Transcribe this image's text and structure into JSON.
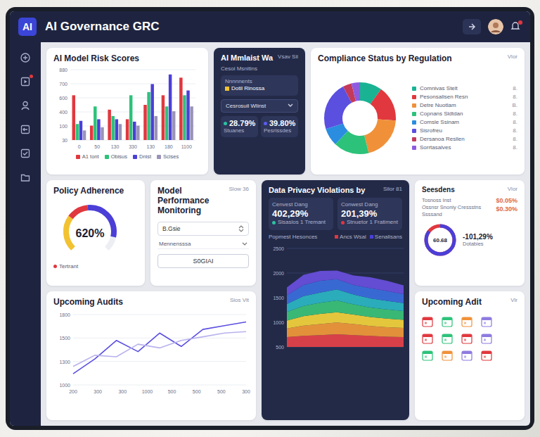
{
  "window": {
    "logo": "AI",
    "title": "AI Governance GRC"
  },
  "header": {
    "notifications_badge": true
  },
  "sidebar": {
    "items": [
      {
        "badge": false
      },
      {
        "badge": true
      },
      {
        "badge": false
      },
      {
        "badge": false
      },
      {
        "badge": false
      },
      {
        "badge": false
      }
    ]
  },
  "risk_chart": {
    "title": "AI Model Risk Scores",
    "y_ticks": [
      "880",
      "700",
      "600",
      "400",
      "100",
      "30"
    ],
    "x_labels": [
      "0",
      "50",
      "130",
      "330",
      "130",
      "180",
      "1100"
    ],
    "max": 880,
    "series": [
      {
        "name": "A1 tont",
        "color": "#e0383e",
        "values": [
          560,
          180,
          380,
          260,
          440,
          560,
          780
        ]
      },
      {
        "name": "Obisus",
        "color": "#2cc27a",
        "values": [
          200,
          420,
          300,
          560,
          600,
          420,
          560
        ]
      },
      {
        "name": "Dnist",
        "color": "#4b3fd8",
        "values": [
          240,
          260,
          260,
          230,
          700,
          820,
          620
        ]
      },
      {
        "name": "Scises",
        "color": "#9a93b8",
        "values": [
          120,
          160,
          200,
          180,
          300,
          360,
          420
        ]
      }
    ]
  },
  "ai_monitor": {
    "title": "AI Mmlaist Wa",
    "link": "Vsav Sii",
    "subtitle": "Cesoi Msnitins",
    "field_label": "Nnnnnents",
    "field_value": "Dotil Rinossa",
    "dropdown": "Cesrosuil Wlinst",
    "stats": [
      {
        "value": "28.79%",
        "label": "Stuanes",
        "color": "#2cc2a0"
      },
      {
        "value": "39.80%",
        "label": "Pesrissdes",
        "color": "#5b5cf0"
      }
    ]
  },
  "compliance": {
    "title": "Compliance Status by Regulation",
    "link": "Vlor",
    "items": [
      {
        "label": "Comnivas Stelt",
        "reading": "8.",
        "color": "#19b394",
        "value": 10
      },
      {
        "label": "Pesonsalisen Resn",
        "reading": "8.",
        "color": "#e0383e",
        "value": 16
      },
      {
        "label": "Detre Nuotlam",
        "reading": "B.",
        "color": "#f0913a",
        "value": 20
      },
      {
        "label": "Copnans Sldtdan",
        "reading": "8.",
        "color": "#2cc27a",
        "value": 16
      },
      {
        "label": "Comsle Ssinam",
        "reading": "8.",
        "color": "#2a8de0",
        "value": 8
      },
      {
        "label": "Sisrofreu",
        "reading": "8.",
        "color": "#5b4fe0",
        "value": 22
      },
      {
        "label": "Dersanoa Resllen",
        "reading": "8.",
        "color": "#c43a5a",
        "value": 4
      },
      {
        "label": "Sorrtasalves",
        "reading": "8.",
        "color": "#8e5be0",
        "value": 4
      }
    ]
  },
  "policy": {
    "title": "Policy Adherence",
    "value": "620%",
    "label": "Tertrant",
    "label_color": "#e0383e",
    "segments": [
      {
        "color": "#f2c230",
        "share": 0.3
      },
      {
        "color": "#e0383e",
        "share": 0.18
      },
      {
        "color": "#4b3fd8",
        "share": 0.4
      }
    ]
  },
  "model_performance": {
    "title": "Model Performance Monitoring",
    "link": "Slow 36",
    "select": "B.Gsie",
    "dropdown": "Mennensssa",
    "button": "S0GIAI"
  },
  "privacy": {
    "title": "Data Privacy Violations by",
    "link": "Silor 81",
    "stats": [
      {
        "label": "Cenvest Dang",
        "value": "402,29%",
        "note": "Sisaslos 1 Tremant",
        "color": "#2cc2a0"
      },
      {
        "label": "Conwest Dang",
        "value": "201,39%",
        "note": "Stnuetor 1 Fratiment",
        "color": "#e0383e"
      }
    ],
    "subtitle": "Popmest Hesonces",
    "legend": [
      {
        "label": "Ancs Wsal",
        "color": "#e0383e"
      },
      {
        "label": "Senalisans",
        "color": "#4b3fd8"
      }
    ],
    "y_ticks": [
      "2500",
      "2000",
      "1500",
      "1000",
      "500"
    ],
    "max": 2500,
    "series": [
      {
        "color": "#e8424a",
        "values": [
          250,
          280,
          300,
          320,
          300,
          280,
          260,
          250
        ]
      },
      {
        "color": "#f39a3a",
        "values": [
          220,
          260,
          280,
          300,
          280,
          250,
          240,
          230
        ]
      },
      {
        "color": "#f5d43c",
        "values": [
          200,
          240,
          260,
          260,
          240,
          230,
          220,
          210
        ]
      },
      {
        "color": "#3cc47a",
        "values": [
          220,
          260,
          280,
          300,
          260,
          240,
          230,
          220
        ]
      },
      {
        "color": "#2bb7c4",
        "values": [
          200,
          250,
          260,
          280,
          250,
          230,
          220,
          200
        ]
      },
      {
        "color": "#3b6fe0",
        "values": [
          220,
          280,
          300,
          260,
          240,
          260,
          250,
          230
        ]
      },
      {
        "color": "#6a4fe0",
        "values": [
          200,
          260,
          250,
          220,
          240,
          280,
          260,
          220
        ]
      }
    ]
  },
  "insights": {
    "title": "Seesdens",
    "link": "Vlor",
    "lines": [
      "Tosnoss Inst",
      "Ossnsr Snoniy Cressstns",
      "Ssssand"
    ],
    "values": [
      "$0.05%",
      "$0.30%"
    ],
    "ring": {
      "text": "60.68",
      "level": 0.85
    },
    "stat": {
      "value": "-101,29%",
      "label": "Dotabies"
    }
  },
  "audits_chart": {
    "title": "Upcoming Audits",
    "link": "Sios Vlt",
    "y_ticks": [
      "1800",
      "1500",
      "1300",
      "1000"
    ],
    "x_labels": [
      "200",
      "300",
      "300",
      "1000",
      "500",
      "500",
      "500",
      "300"
    ],
    "min": 900,
    "max": 1850,
    "series": [
      {
        "color": "#5b4fe0",
        "values": [
          1050,
          1250,
          1500,
          1350,
          1600,
          1420,
          1650,
          1700,
          1750
        ]
      },
      {
        "color": "#b8b2ec",
        "values": [
          1150,
          1300,
          1280,
          1450,
          1400,
          1500,
          1550,
          1600,
          1620
        ]
      }
    ]
  },
  "upcoming": {
    "title": "Upcoming Adit",
    "link": "Vlr",
    "events": [
      {
        "color": "#e0383e"
      },
      {
        "color": "#2cc27a"
      },
      {
        "color": "#f0913a"
      },
      {
        "color": "#8e7be0"
      },
      {
        "color": "#e0383e"
      },
      {
        "color": "#2cc27a"
      },
      {
        "color": "#e0383e"
      },
      {
        "color": "#8e7be0"
      },
      {
        "color": "#2cc27a"
      },
      {
        "color": "#f0913a"
      },
      {
        "color": "#8e7be0"
      },
      {
        "color": "#e0383e"
      }
    ]
  }
}
